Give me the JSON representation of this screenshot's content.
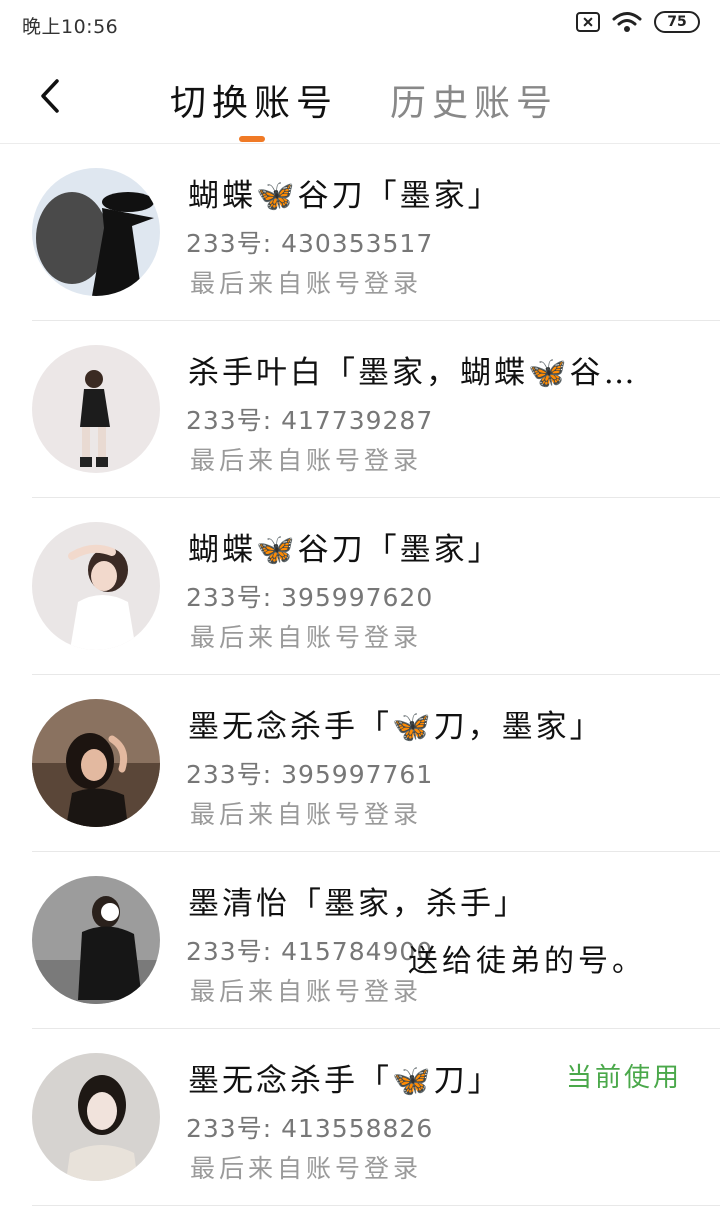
{
  "status_bar": {
    "time": "晚上10:56",
    "battery": "75"
  },
  "header": {
    "tabs": [
      {
        "label": "切换账号",
        "active": true
      },
      {
        "label": "历史账号",
        "active": false
      }
    ]
  },
  "accounts": [
    {
      "name": "蝴蝶🦋谷刀「墨家」",
      "uid": "233号: 430353517",
      "last_login": "最后来自账号登录"
    },
    {
      "name": "杀手叶白「墨家，蝴蝶🦋谷…",
      "uid": "233号: 417739287",
      "last_login": "最后来自账号登录"
    },
    {
      "name": "蝴蝶🦋谷刀「墨家」",
      "uid": "233号: 395997620",
      "last_login": "最后来自账号登录"
    },
    {
      "name": "墨无念杀手「🦋刀，墨家」",
      "uid": "233号: 395997761",
      "last_login": "最后来自账号登录"
    },
    {
      "name": "墨清怡「墨家，杀手」",
      "uid": "233号: 415784900",
      "last_login": "最后来自账号登录",
      "note": "送给徒弟的号。"
    },
    {
      "name": "墨无念杀手「🦋刀」",
      "uid": "233号: 413558826",
      "last_login": "最后来自账号登录",
      "badge": "当前使用"
    }
  ],
  "colors": {
    "accent": "#f07a26",
    "current_badge": "#4aa84a",
    "secondary_text": "#9a9a9a"
  }
}
